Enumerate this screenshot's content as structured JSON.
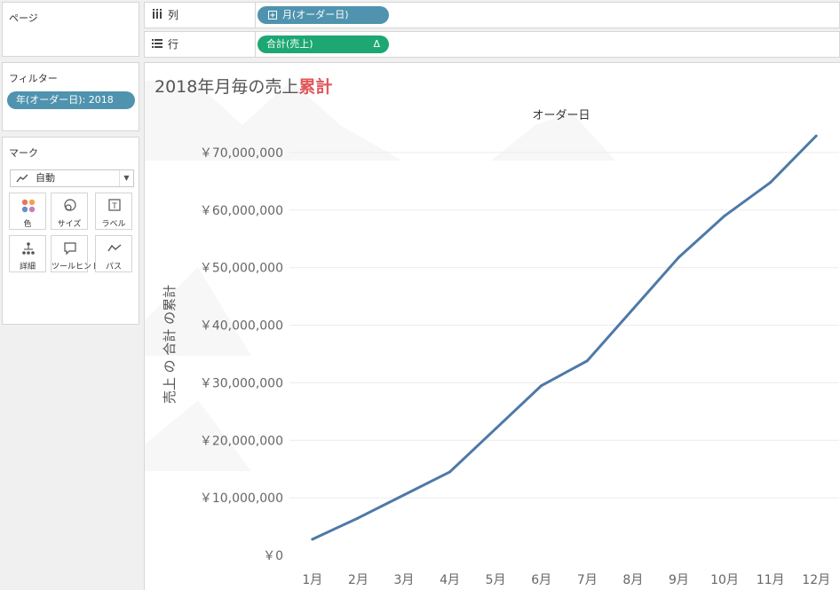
{
  "left_panel": {
    "pages_title": "ページ",
    "filters_title": "フィルター",
    "filter_pills": [
      "年(オーダー日): 2018"
    ],
    "marks_title": "マーク",
    "mark_type": "自動",
    "mark_buttons": [
      {
        "label": "色",
        "icon": "color-icon"
      },
      {
        "label": "サイズ",
        "icon": "size-icon"
      },
      {
        "label": "ラベル",
        "icon": "label-icon"
      },
      {
        "label": "詳細",
        "icon": "detail-icon"
      },
      {
        "label": "ツールヒント",
        "icon": "tooltip-icon"
      },
      {
        "label": "パス",
        "icon": "path-icon"
      }
    ]
  },
  "shelves": {
    "columns_label": "列",
    "columns_pill": "月(オーダー日)",
    "rows_label": "行",
    "rows_pill": "合計(売上)",
    "rows_pill_badge": "Δ"
  },
  "colors": {
    "pill_dimension": "#4f93ae",
    "pill_measure": "#1da772",
    "line": "#4e79a7",
    "title_accent": "#e15759"
  },
  "chart_data": {
    "type": "line",
    "title_prefix": "2018年月毎の売上",
    "title_accent": "累計",
    "header": "オーダー日",
    "ylabel": "売上 の 合計 の累計",
    "categories": [
      "1月",
      "2月",
      "3月",
      "4月",
      "5月",
      "6月",
      "7月",
      "8月",
      "9月",
      "10月",
      "11月",
      "12月"
    ],
    "values": [
      2800000,
      6500000,
      10500000,
      14500000,
      22000000,
      29500000,
      33800000,
      42800000,
      51800000,
      59000000,
      64800000,
      72900000
    ],
    "ylim": [
      0,
      75000000
    ],
    "yticks": [
      0,
      10000000,
      20000000,
      30000000,
      40000000,
      50000000,
      60000000,
      70000000
    ],
    "ytick_labels": [
      "￥0",
      "￥10,000,000",
      "￥20,000,000",
      "￥30,000,000",
      "￥40,000,000",
      "￥50,000,000",
      "￥60,000,000",
      "￥70,000,000"
    ],
    "grid": true
  }
}
